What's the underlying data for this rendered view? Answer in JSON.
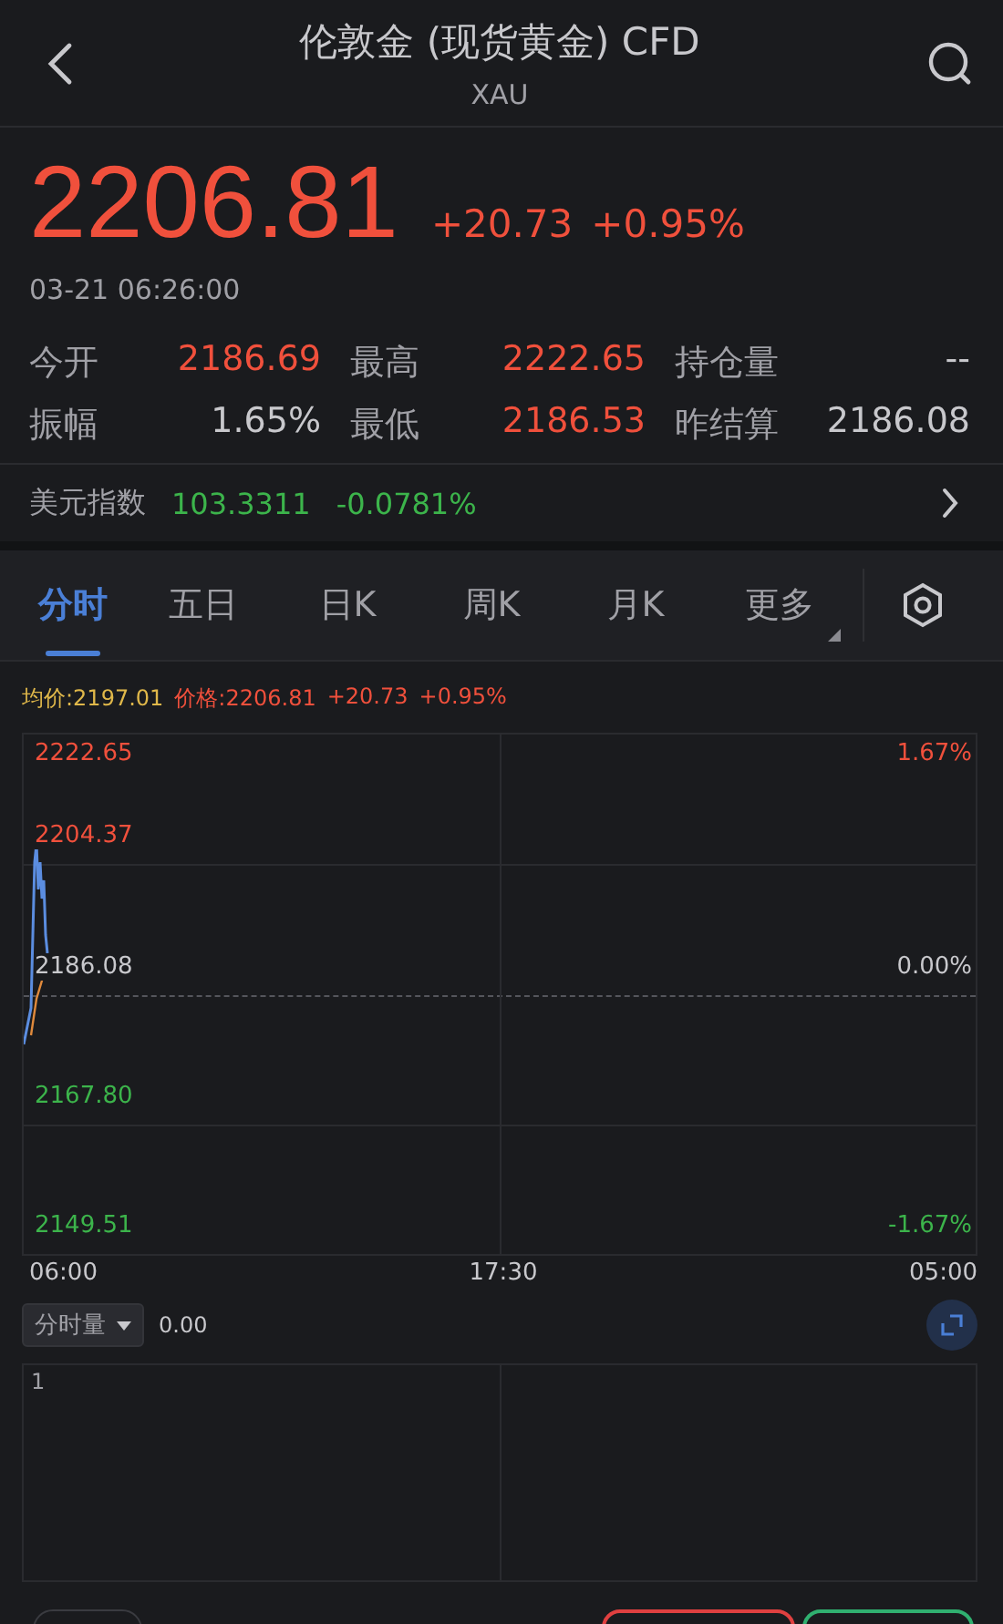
{
  "header": {
    "title": "伦敦金 (现货黄金) CFD",
    "subtitle": "XAU"
  },
  "quote": {
    "price": "2206.81",
    "change": "+20.73",
    "change_pct": "+0.95%",
    "time": "03-21 06:26:00",
    "color": "#f0503c"
  },
  "stats": [
    {
      "label": "今开",
      "value": "2186.69",
      "color": "#f0503c"
    },
    {
      "label": "最高",
      "value": "2222.65",
      "color": "#f0503c"
    },
    {
      "label": "持仓量",
      "value": "--",
      "color": "#c8c8cc"
    },
    {
      "label": "振幅",
      "value": "1.65%",
      "color": "#c8c8cc"
    },
    {
      "label": "最低",
      "value": "2186.53",
      "color": "#f0503c"
    },
    {
      "label": "昨结算",
      "value": "2186.08",
      "color": "#c8c8cc"
    }
  ],
  "index": {
    "label": "美元指数",
    "value": "103.3311",
    "change": "-0.0781%",
    "color": "#3cb44b"
  },
  "tabs": [
    {
      "label": "分时",
      "selected": true,
      "dropdown": false
    },
    {
      "label": "五日",
      "selected": false,
      "dropdown": false
    },
    {
      "label": "日K",
      "selected": false,
      "dropdown": false
    },
    {
      "label": "周K",
      "selected": false,
      "dropdown": false
    },
    {
      "label": "月K",
      "selected": false,
      "dropdown": false
    },
    {
      "label": "更多",
      "selected": false,
      "dropdown": true
    }
  ],
  "legend": {
    "avg": "均价:2197.01",
    "price": "价格:2206.81",
    "change": "+20.73",
    "change_pct": "+0.95%"
  },
  "y_labels_left": [
    {
      "text": "2222.65",
      "color": "#f0503c"
    },
    {
      "text": "2204.37",
      "color": "#f0503c"
    },
    {
      "text": "2186.08",
      "color": "#c8c8cc"
    },
    {
      "text": "2167.80",
      "color": "#3cb44b"
    },
    {
      "text": "2149.51",
      "color": "#3cb44b"
    }
  ],
  "y_labels_right": [
    {
      "text": "1.67%",
      "color": "#f0503c"
    },
    {
      "text": "0.00%",
      "color": "#c8c8cc"
    },
    {
      "text": "-1.67%",
      "color": "#3cb44b"
    }
  ],
  "x_labels": [
    "06:00",
    "17:30",
    "05:00"
  ],
  "volume": {
    "selector": "分时量",
    "value": "0.00",
    "scale": "1"
  }
}
